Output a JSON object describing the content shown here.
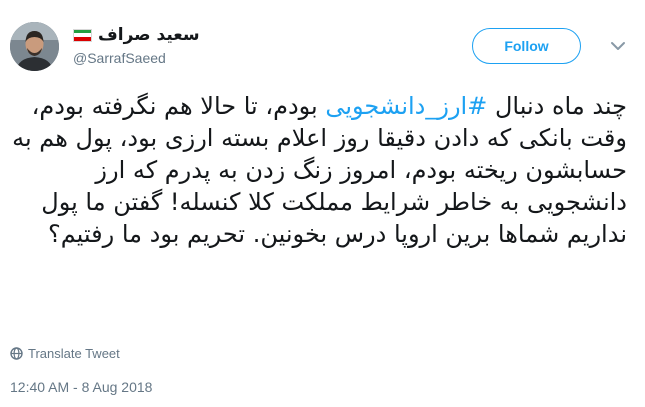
{
  "author": {
    "display_name": "سعید صراف",
    "handle": "@SarrafSaeed",
    "flag_colors": [
      "#239f40",
      "#ffffff",
      "#da0000"
    ]
  },
  "follow_label": "Follow",
  "tweet": {
    "prefix": "چند ماه دنبال ",
    "hashtag": "#ارز_دانشجویی",
    "suffix": " بودم، تا حالا هم نگرفته بودم، وقت بانکی که دادن دقیقا روز اعلام بسته ارزی بود، پول هم به حسابشون ریخته بودم، امروز زنگ زدن به پدرم که ارز دانشجویی به خاطر شرایط مملکت کلا کنسله! گفتن ما پول نداریم شماها برین اروپا درس بخونین. تحریم بود ما رفتیم؟"
  },
  "translate_label": "Translate Tweet",
  "timestamp": "12:40 AM - 8 Aug 2018",
  "colors": {
    "accent": "#1da1f2",
    "text": "#14171a",
    "muted": "#657786"
  }
}
